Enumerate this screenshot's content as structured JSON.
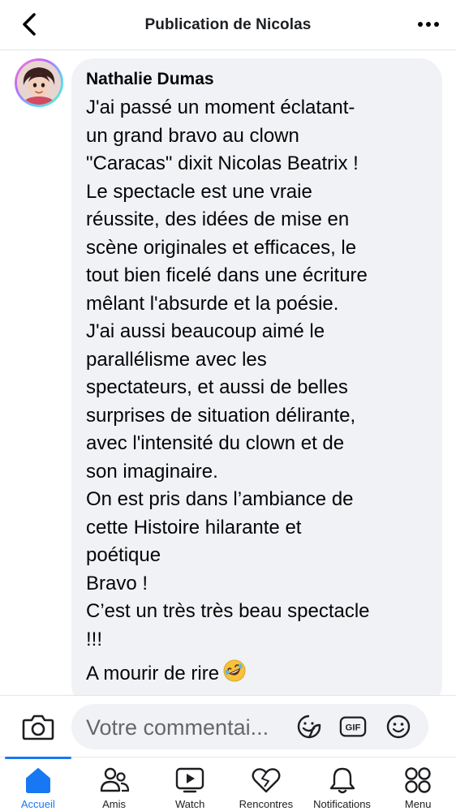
{
  "header": {
    "title": "Publication de Nicolas"
  },
  "comment": {
    "author": "Nathalie Dumas",
    "lines": [
      "J'ai passé un moment éclatant-",
      "un grand bravo au clown",
      "\"Caracas\" dixit Nicolas Beatrix !",
      "Le spectacle est une vraie",
      "réussite,  des idées de mise en",
      "scène originales et efficaces, le",
      "tout bien ficelé dans une écriture",
      "mêlant l'absurde et la poésie.",
      "J'ai aussi beaucoup aimé le",
      "parallélisme avec les",
      "spectateurs, et aussi de belles",
      "surprises de situation délirante,",
      "avec l'intensité du clown et de",
      "son imaginaire.",
      "On est pris dans l’ambiance de",
      "cette Histoire hilarante et",
      "poétique",
      "Bravo !",
      "C’est un très très beau spectacle",
      "!!!",
      "A mourir de rire"
    ],
    "trailing_emoji": "rolling-on-floor-laughing"
  },
  "composer": {
    "placeholder": "Votre commentai...",
    "icons": [
      "camera-icon",
      "sticker-icon",
      "gif-icon",
      "emoji-icon"
    ],
    "gif_label": "GIF"
  },
  "nav": {
    "items": [
      {
        "label": "Accueil",
        "icon": "home-icon",
        "active": true
      },
      {
        "label": "Amis",
        "icon": "friends-icon",
        "active": false
      },
      {
        "label": "Watch",
        "icon": "watch-icon",
        "active": false
      },
      {
        "label": "Rencontres",
        "icon": "heart-icon",
        "active": false
      },
      {
        "label": "Notifications",
        "icon": "bell-icon",
        "active": false
      },
      {
        "label": "Menu",
        "icon": "menu-grid-icon",
        "active": false
      }
    ]
  },
  "colors": {
    "accent": "#1877f2",
    "bubble": "#f0f2f5",
    "text": "#050505",
    "muted": "#65676b"
  }
}
